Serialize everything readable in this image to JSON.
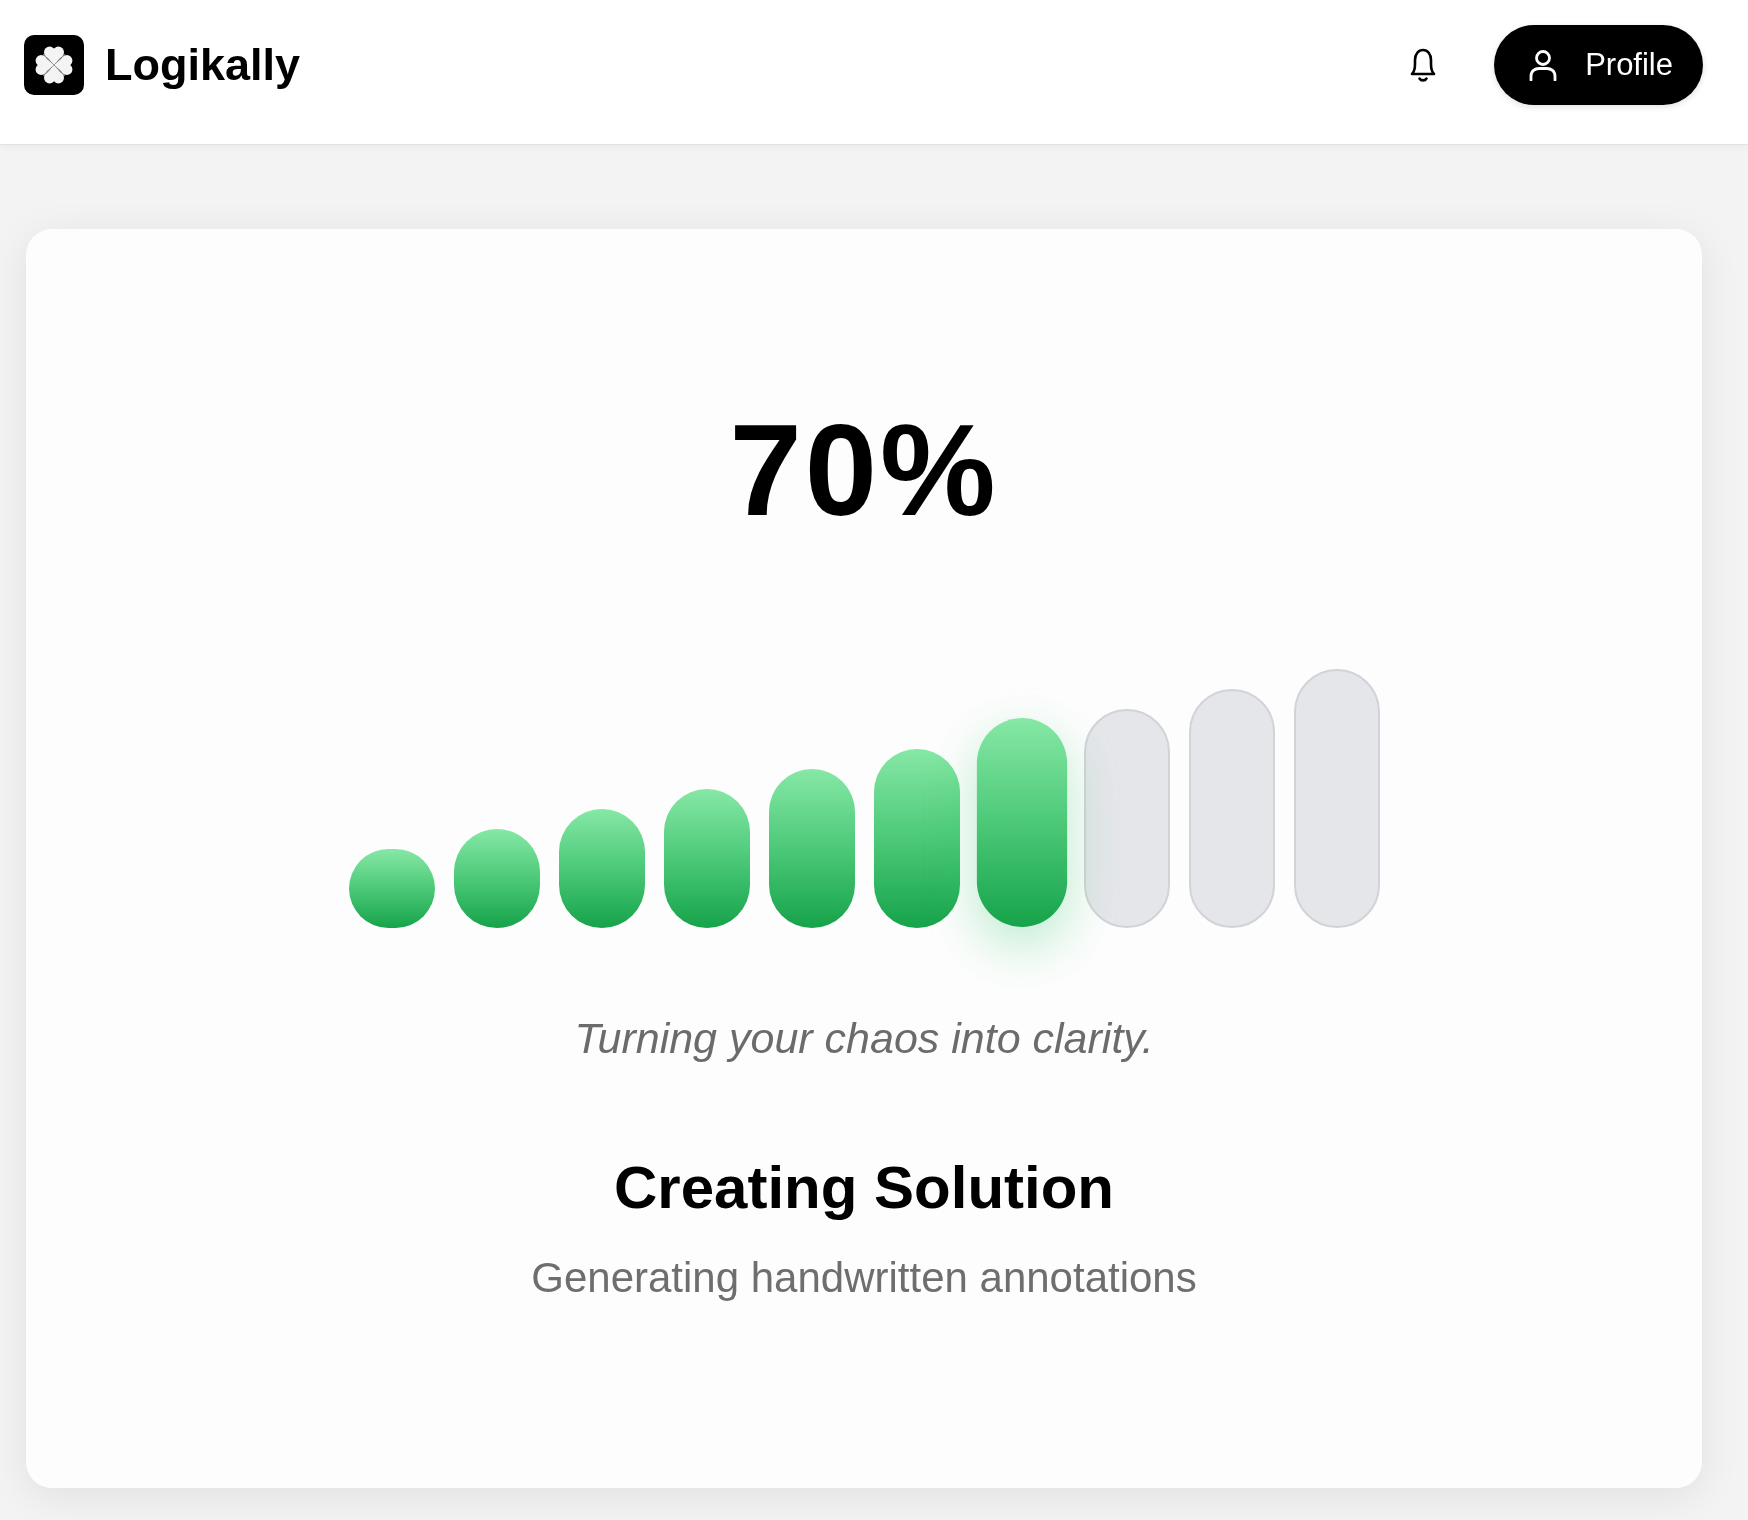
{
  "header": {
    "brand": "Logikally",
    "profile_button": {
      "label": "Profile"
    }
  },
  "progress": {
    "percent": "70%",
    "segments": [
      {
        "filled": true,
        "current": false
      },
      {
        "filled": true,
        "current": false
      },
      {
        "filled": true,
        "current": false
      },
      {
        "filled": true,
        "current": false
      },
      {
        "filled": true,
        "current": false
      },
      {
        "filled": true,
        "current": false
      },
      {
        "filled": true,
        "current": true
      },
      {
        "filled": false,
        "current": false
      },
      {
        "filled": false,
        "current": false
      },
      {
        "filled": false,
        "current": false
      }
    ]
  },
  "tagline": "Turning your chaos into clarity.",
  "status": {
    "title": "Creating Solution",
    "detail": "Generating handwritten annotations"
  }
}
